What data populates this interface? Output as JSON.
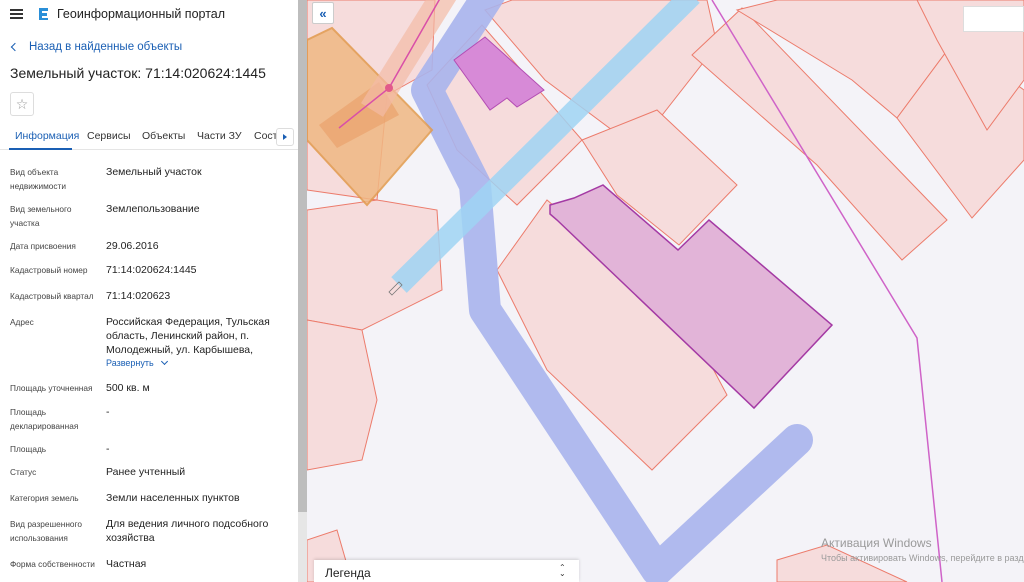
{
  "header": {
    "title": "Геоинформационный портал",
    "menu_icon": "hamburger-icon",
    "logo_icon": "portal-logo-icon"
  },
  "back_link": "Назад в найденные объекты",
  "page_title": "Земельный участок: 71:14:020624:1445",
  "tabs": [
    {
      "label": "Информация",
      "active": true
    },
    {
      "label": "Сервисы"
    },
    {
      "label": "Объекты"
    },
    {
      "label": "Части ЗУ"
    },
    {
      "label": "Состав ЕЗП"
    }
  ],
  "properties": [
    {
      "key": "Вид объекта недвижимости",
      "value": "Земельный участок"
    },
    {
      "key": "Вид земельного участка",
      "value": "Землепользование"
    },
    {
      "key": "Дата присвоения",
      "value": "29.06.2016"
    },
    {
      "key": "Кадастровый номер",
      "value": "71:14:020624:1445"
    },
    {
      "key": "Кадастровый квартал",
      "value": "71:14:020623"
    },
    {
      "key": "Адрес",
      "value": "Российская Федерация, Тульская область, Ленинский район, п. Молодежный, ул. Карбышева,"
    },
    {
      "key": "Площадь уточненная",
      "value": "500 кв. м"
    },
    {
      "key": "Площадь декларированная",
      "value": "-"
    },
    {
      "key": "Площадь",
      "value": "-"
    },
    {
      "key": "Статус",
      "value": "Ранее учтенный"
    },
    {
      "key": "Категория земель",
      "value": "Земли населенных пунктов"
    },
    {
      "key": "Вид разрешенного использования",
      "value": "Для ведения личного подсобного хозяйства"
    },
    {
      "key": "Форма собственности",
      "value": "Частная"
    }
  ],
  "expand_label": "Развернуть",
  "map": {
    "collapse_label": "«",
    "legend_label": "Легенда",
    "watermark_title": "Активация Windows",
    "watermark_text": "Чтобы активировать Windows, перейдите в раздел"
  },
  "colors": {
    "accent": "#1a5fb4",
    "parcel_fill": "#f6dcdc",
    "parcel_stroke": "#ec7b6b",
    "building_fill": "#d98ad9",
    "road": "#a9b4ec",
    "pipe": "#9fd3f3"
  }
}
